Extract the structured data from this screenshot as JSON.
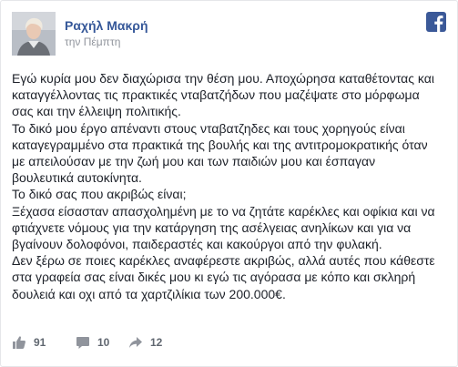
{
  "post": {
    "author": "Ραχήλ Μακρή",
    "timestamp": "την Πέμπτη",
    "lines": [
      "Εγώ κυρία μου δεν διαχώρισα την θέση μου. Αποχώρησα καταθέτοντας και",
      "καταγγέλλοντας τις πρακτικές νταβατζήδων που μαζέψατε στο μόρφωμα",
      "σας και την έλλειψη πολιτικής.",
      "Το δικό μου έργο απέναντι στους νταβατζηδες και τους χορηγούς είναι",
      "καταγεγραμμένο στα πρακτικά της βουλής και της αντιτρομοκρατικής όταν",
      "με απειλούσαν με την ζωή μου και των παιδιών μου και έσπαγαν",
      "βουλευτικά αυτοκίνητα.",
      "Το δικό σας που ακριβώς είναι;",
      "Ξέχασα είσασταν απασχολημένη με το να ζητάτε καρέκλες και οφίκια και να",
      "φτιάχνετε νόμους για την κατάργηση της ασέλγειας ανηλίκων και για να",
      "βγαίνουν δολοφόνοι, παιδεραστές και κακούργοι από την φυλακή.",
      "Δεν ξέρω σε ποιες καρέκλες αναφέρεστε ακριβώς, αλλά αυτές που κάθεστε",
      "στα γραφεία σας είναι δικές μου κι εγώ τις αγόρασα με κόπο και σκληρή",
      "δουλειά και οχι από τα χαρτζιλίκια των 200.000€."
    ]
  },
  "stats": {
    "likes": "91",
    "comments": "10",
    "shares": "12"
  },
  "colors": {
    "author_link": "#365899",
    "facebook_blue": "#3b5998",
    "text": "#1d2129",
    "meta": "#90949c",
    "icon_gray": "#90949c"
  },
  "icons": {
    "brand": "facebook-logo-icon",
    "like": "thumbs-up-icon",
    "comment": "comment-bubble-icon",
    "share": "share-arrow-icon"
  }
}
